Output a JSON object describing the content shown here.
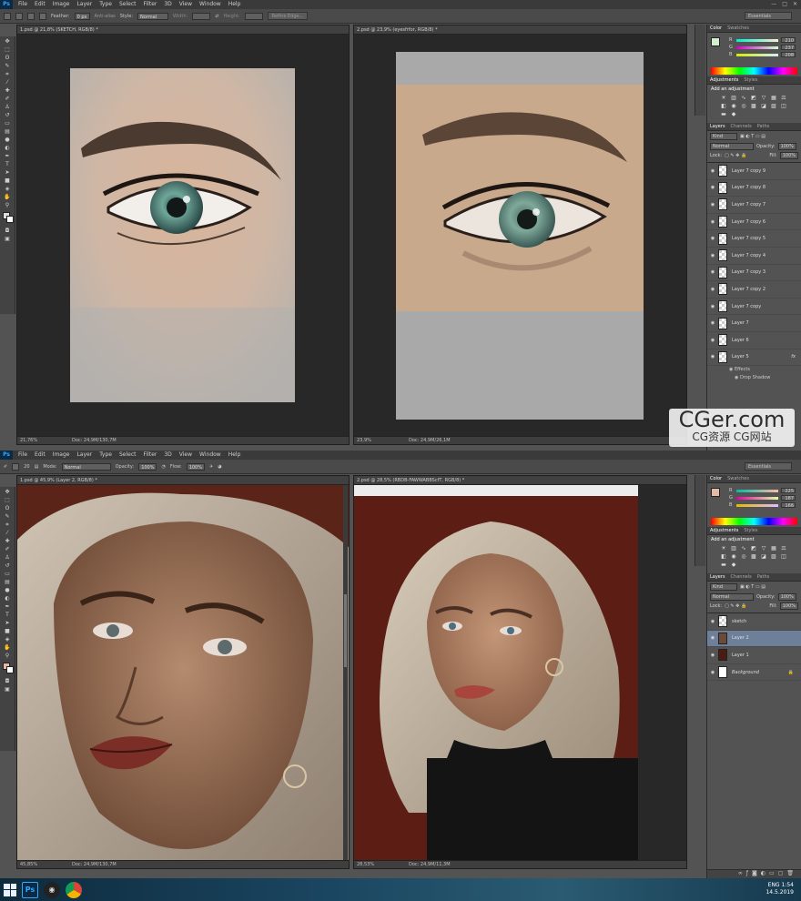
{
  "menu": {
    "items": [
      "File",
      "Edit",
      "Image",
      "Layer",
      "Type",
      "Select",
      "Filter",
      "3D",
      "View",
      "Window",
      "Help"
    ],
    "app_badge": "Ps"
  },
  "top": {
    "options": {
      "feather_label": "Feather:",
      "feather_value": "0 px",
      "antialias_label": "Anti-alias",
      "style_label": "Style:",
      "style_value": "Normal",
      "width_label": "Width:",
      "height_label": "Height:",
      "refine_edge": "Refine Edge...",
      "workspace": "Essentials"
    },
    "doc1": {
      "tab": "1.psd @ 21,8% (SKETCH, RGB/8) *",
      "zoom": "21,76%",
      "doc": "Doc: 24,9M/130,7M"
    },
    "doc2": {
      "tab": "2.psd @ 23,9% (eyesfrfor, RGB/8) *",
      "zoom": "23,9%",
      "doc": "Doc: 24,9M/26,1M"
    },
    "color": {
      "tabs": [
        "Color",
        "Swatches"
      ],
      "r": "210",
      "g": "237",
      "b": "208"
    },
    "adjustments": {
      "tabs": [
        "Adjustments",
        "Styles"
      ],
      "title": "Add an adjustment"
    },
    "layers": {
      "tabs": [
        "Layers",
        "Channels",
        "Paths"
      ],
      "kind": "Kind",
      "blend": "Normal",
      "opacity_label": "Opacity:",
      "opacity": "100%",
      "lock_label": "Lock:",
      "fill_label": "Fill:",
      "fill": "100%",
      "items": [
        "Layer 7 copy 9",
        "Layer 7 copy 8",
        "Layer 7 copy 7",
        "Layer 7 copy 6",
        "Layer 7 copy 5",
        "Layer 7 copy 4",
        "Layer 7 copy 3",
        "Layer 7 copy 2",
        "Layer 7 copy",
        "Layer 7",
        "Layer 6",
        "Layer 5"
      ],
      "effects": "Effects",
      "drop_shadow": "Drop Shadow"
    }
  },
  "bottom": {
    "bridge_tabs": [
      "Mini Bridge",
      "Timeline"
    ],
    "options": {
      "mode_label": "Mode:",
      "mode_value": "Normal",
      "opacity_label": "Opacity:",
      "opacity_value": "100%",
      "flow_label": "Flow:",
      "flow_value": "100%",
      "brush_size": "20",
      "workspace": "Essentials"
    },
    "doc1": {
      "tab": "1.psd @ 45,9% (Layer 2, RGB/8) *",
      "zoom": "45,85%",
      "doc": "Doc: 24,9M/130,7M"
    },
    "doc2": {
      "tab": "2.psd @ 28,5% (RBDB-FAWWABBScfT, RGB/8) *",
      "zoom": "28,53%",
      "doc": "Doc: 24,9M/11,3M"
    },
    "color": {
      "tabs": [
        "Color",
        "Swatches"
      ],
      "r": "225",
      "g": "187",
      "b": "166"
    },
    "adjustments": {
      "tabs": [
        "Adjustments",
        "Styles"
      ],
      "title": "Add an adjustment"
    },
    "layers": {
      "tabs": [
        "Layers",
        "Channels",
        "Paths"
      ],
      "kind": "Kind",
      "blend": "Normal",
      "opacity_label": "Opacity:",
      "opacity": "100%",
      "lock_label": "Lock:",
      "fill_label": "Fill:",
      "fill": "100%",
      "items": [
        "sketch",
        "Layer 2",
        "Layer 1",
        "Background"
      ]
    }
  },
  "watermark": {
    "line1": "CGer.com",
    "line2": "CG资源 CG网站"
  },
  "taskbar": {
    "ps": "Ps",
    "lang": "ENG",
    "time": "1:54",
    "date": "14.5.2019"
  }
}
